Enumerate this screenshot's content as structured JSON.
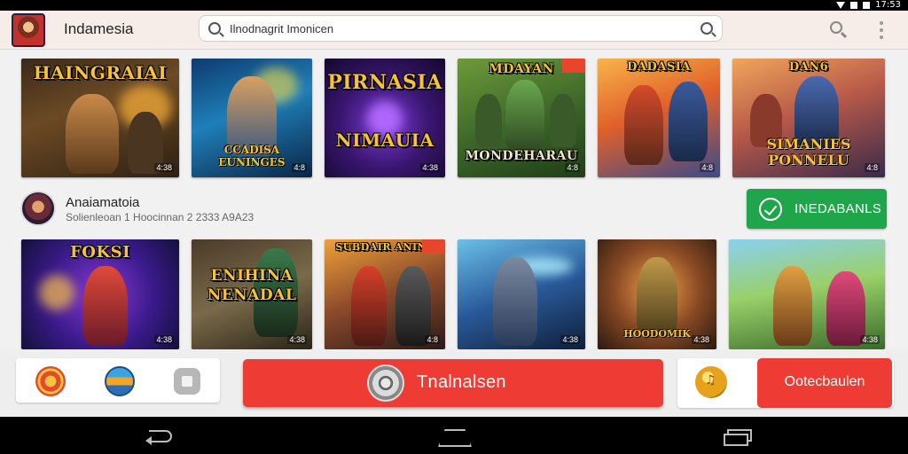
{
  "status_bar": {
    "time": "17:53"
  },
  "app_bar": {
    "title": "Indamesia",
    "search_value": "Ilnodnagrit Imonicen"
  },
  "row1": [
    {
      "title": "HAINGRAIAI",
      "subtitle": "",
      "badge": "4:38"
    },
    {
      "title": "",
      "subtitle": "CCADISA EUNINGES",
      "badge": "4:8"
    },
    {
      "title": "PIRNASIA",
      "subtitle": "NIMAUIA",
      "badge": "4:38"
    },
    {
      "title": "MDAYAN",
      "subtitle": "MONDEHARAU",
      "badge": "4:8"
    },
    {
      "title": "DADASIA",
      "subtitle": "",
      "badge": "4:8"
    },
    {
      "title": "DAN6",
      "subtitle": "SIMANIES PONNELU",
      "badge": "4:8"
    }
  ],
  "developer": {
    "name": "Anaiamatoia",
    "meta": "Solienleoan  1 Hoocinnan  2 2333 A9A23",
    "install_label": "INEDABANLS"
  },
  "row2": [
    {
      "title": "FOKSI",
      "subtitle": "",
      "badge": "4:38"
    },
    {
      "title": "ENIHINA NENADAL",
      "subtitle": "",
      "badge": "4:38"
    },
    {
      "title": "SUBDAIR ANINS",
      "subtitle": "",
      "badge": "4:8"
    },
    {
      "title": "",
      "subtitle": "",
      "badge": "4:38"
    },
    {
      "title": "",
      "subtitle": "HOODOMIK",
      "badge": "4:38"
    },
    {
      "title": "",
      "subtitle": "",
      "badge": "4:38"
    }
  ],
  "actions": {
    "primary_label": "Tnalnalsen",
    "secondary_label": "Ootecbaulen"
  },
  "colors": {
    "install_green": "#1fa64a",
    "action_red": "#ee3b33",
    "appbar_bg": "#f6ece8"
  },
  "icons": [
    "target-icon",
    "globe-icon",
    "square-icon",
    "coin-icon",
    "disc-icon",
    "check-icon",
    "search-icon",
    "more-vert-icon",
    "back-icon",
    "home-icon",
    "recents-icon"
  ]
}
